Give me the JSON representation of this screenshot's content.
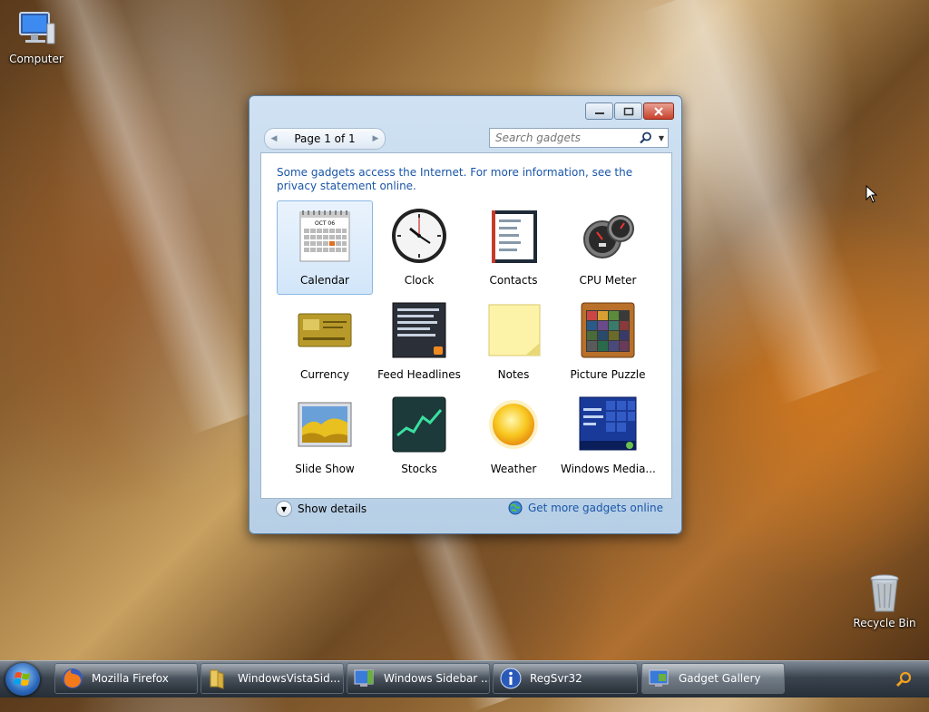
{
  "desktop": {
    "computer_label": "Computer",
    "recycle_label": "Recycle Bin"
  },
  "window": {
    "pager_label": "Page 1 of 1",
    "search_placeholder": "Search gadgets",
    "notice": "Some gadgets access the Internet.  For more information, see the privacy statement online.",
    "gadgets": [
      {
        "name": "Calendar",
        "icon": "calendar-icon",
        "selected": true
      },
      {
        "name": "Clock",
        "icon": "clock-icon"
      },
      {
        "name": "Contacts",
        "icon": "contacts-icon"
      },
      {
        "name": "CPU Meter",
        "icon": "cpu-meter-icon"
      },
      {
        "name": "Currency",
        "icon": "currency-icon"
      },
      {
        "name": "Feed Headlines",
        "icon": "feed-headlines-icon"
      },
      {
        "name": "Notes",
        "icon": "notes-icon"
      },
      {
        "name": "Picture Puzzle",
        "icon": "picture-puzzle-icon"
      },
      {
        "name": "Slide Show",
        "icon": "slide-show-icon"
      },
      {
        "name": "Stocks",
        "icon": "stocks-icon"
      },
      {
        "name": "Weather",
        "icon": "weather-icon"
      },
      {
        "name": "Windows Media...",
        "icon": "windows-media-icon"
      }
    ],
    "calendar_month": "OCT 06",
    "show_details": "Show details",
    "get_more": "Get more gadgets online"
  },
  "taskbar": {
    "items": [
      {
        "label": "Mozilla Firefox",
        "icon": "firefox-icon"
      },
      {
        "label": "WindowsVistaSid...",
        "icon": "folder-icon"
      },
      {
        "label": "Windows Sidebar ...",
        "icon": "sidebar-icon"
      },
      {
        "label": "RegSvr32",
        "icon": "info-icon"
      },
      {
        "label": "Gadget Gallery",
        "icon": "gadget-gallery-icon",
        "active": true
      }
    ]
  },
  "colors": {
    "link": "#1a56a8",
    "selection": "#d2e6fa",
    "window_frame": "#b7cfe6"
  }
}
